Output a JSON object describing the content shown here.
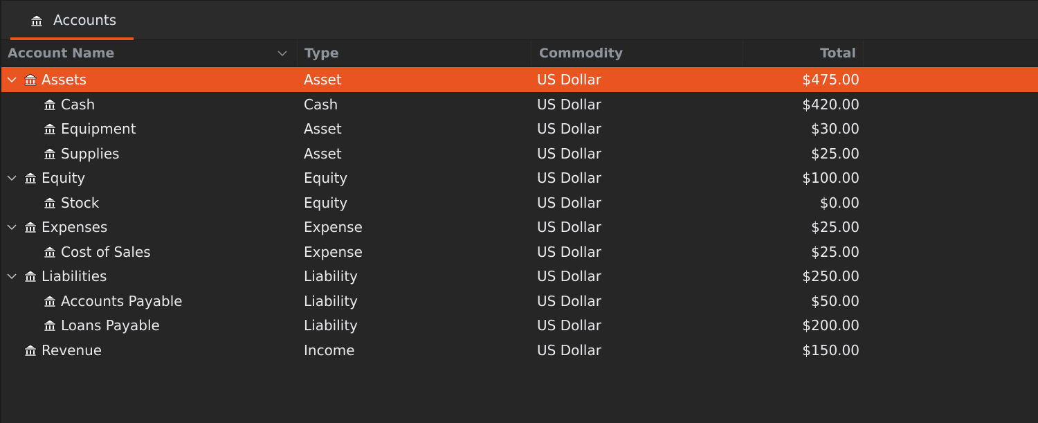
{
  "tab": {
    "label": "Accounts",
    "icon": "bank-icon"
  },
  "columns": {
    "name": "Account Name",
    "type": "Type",
    "commodity": "Commodity",
    "total": "Total",
    "sort_indicator": "chevron-down-icon"
  },
  "colors": {
    "accent": "#e95420",
    "background": "#262626",
    "text": "#e8eaed",
    "header_text": "#8e949c"
  },
  "accounts": [
    {
      "name": "Assets",
      "type": "Asset",
      "commodity": "US Dollar",
      "total": "$475.00",
      "level": 0,
      "expandable": true,
      "expanded": true,
      "selected": true
    },
    {
      "name": "Cash",
      "type": "Cash",
      "commodity": "US Dollar",
      "total": "$420.00",
      "level": 1,
      "expandable": false,
      "selected": false
    },
    {
      "name": "Equipment",
      "type": "Asset",
      "commodity": "US Dollar",
      "total": "$30.00",
      "level": 1,
      "expandable": false,
      "selected": false
    },
    {
      "name": "Supplies",
      "type": "Asset",
      "commodity": "US Dollar",
      "total": "$25.00",
      "level": 1,
      "expandable": false,
      "selected": false
    },
    {
      "name": "Equity",
      "type": "Equity",
      "commodity": "US Dollar",
      "total": "$100.00",
      "level": 0,
      "expandable": true,
      "expanded": true,
      "selected": false
    },
    {
      "name": "Stock",
      "type": "Equity",
      "commodity": "US Dollar",
      "total": "$0.00",
      "level": 1,
      "expandable": false,
      "selected": false
    },
    {
      "name": "Expenses",
      "type": "Expense",
      "commodity": "US Dollar",
      "total": "$25.00",
      "level": 0,
      "expandable": true,
      "expanded": true,
      "selected": false
    },
    {
      "name": "Cost of Sales",
      "type": "Expense",
      "commodity": "US Dollar",
      "total": "$25.00",
      "level": 1,
      "expandable": false,
      "selected": false
    },
    {
      "name": "Liabilities",
      "type": "Liability",
      "commodity": "US Dollar",
      "total": "$250.00",
      "level": 0,
      "expandable": true,
      "expanded": true,
      "selected": false
    },
    {
      "name": "Accounts Payable",
      "type": "Liability",
      "commodity": "US Dollar",
      "total": "$50.00",
      "level": 1,
      "expandable": false,
      "selected": false
    },
    {
      "name": "Loans Payable",
      "type": "Liability",
      "commodity": "US Dollar",
      "total": "$200.00",
      "level": 1,
      "expandable": false,
      "selected": false
    },
    {
      "name": "Revenue",
      "type": "Income",
      "commodity": "US Dollar",
      "total": "$150.00",
      "level": 0,
      "expandable": false,
      "selected": false
    }
  ]
}
